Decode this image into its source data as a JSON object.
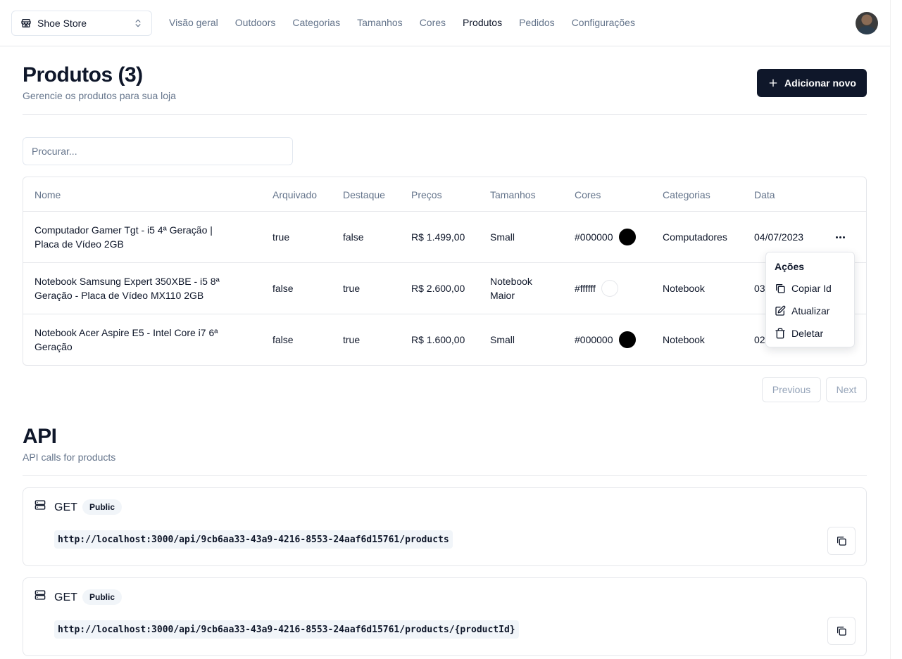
{
  "store_switcher": {
    "label": "Shoe Store",
    "icon": "store-icon"
  },
  "nav": [
    "Visão geral",
    "Outdoors",
    "Categorias",
    "Tamanhos",
    "Cores",
    "Produtos",
    "Pedidos",
    "Configurações"
  ],
  "nav_active": "Produtos",
  "header": {
    "title": "Produtos (3)",
    "subtitle": "Gerencie os produtos para sua loja",
    "add_label": "Adicionar novo"
  },
  "search": {
    "placeholder": "Procurar...",
    "value": ""
  },
  "table": {
    "columns": [
      "Nome",
      "Arquivado",
      "Destaque",
      "Preços",
      "Tamanhos",
      "Cores",
      "Categorias",
      "Data"
    ],
    "rows": [
      {
        "name": "Computador Gamer Tgt - i5 4ª Geração | Placa de Vídeo 2GB",
        "archived": "true",
        "featured": "false",
        "price": "R$ 1.499,00",
        "size": "Small",
        "color": "#000000",
        "category": "Computadores",
        "date": "04/07/2023"
      },
      {
        "name": "Notebook Samsung Expert 350XBE - i5 8ª Geração - Placa de Vídeo MX110 2GB",
        "archived": "false",
        "featured": "true",
        "price": "R$ 2.600,00",
        "size": "Notebook Maior",
        "color": "#ffffff",
        "category": "Notebook",
        "date": "03"
      },
      {
        "name": "Notebook Acer Aspire E5 - Intel Core i7 6ª Geração",
        "archived": "false",
        "featured": "true",
        "price": "R$ 1.600,00",
        "size": "Small",
        "color": "#000000",
        "category": "Notebook",
        "date": "02"
      }
    ]
  },
  "actions_menu": {
    "label": "Ações",
    "items": [
      {
        "label": "Copiar Id",
        "icon": "copy-icon"
      },
      {
        "label": "Atualizar",
        "icon": "edit-icon"
      },
      {
        "label": "Deletar",
        "icon": "trash-icon"
      }
    ]
  },
  "pagination": {
    "previous": "Previous",
    "next": "Next"
  },
  "api": {
    "title": "API",
    "subtitle": "API calls for products",
    "endpoints": [
      {
        "method": "GET",
        "badge": "Public",
        "url": "http://localhost:3000/api/9cb6aa33-43a9-4216-8553-24aaf6d15761/products"
      },
      {
        "method": "GET",
        "badge": "Public",
        "url": "http://localhost:3000/api/9cb6aa33-43a9-4216-8553-24aaf6d15761/products/{productId}"
      }
    ]
  },
  "colors": {
    "primary": "#0f172a",
    "muted": "#64748b",
    "border": "#e5e7eb"
  }
}
